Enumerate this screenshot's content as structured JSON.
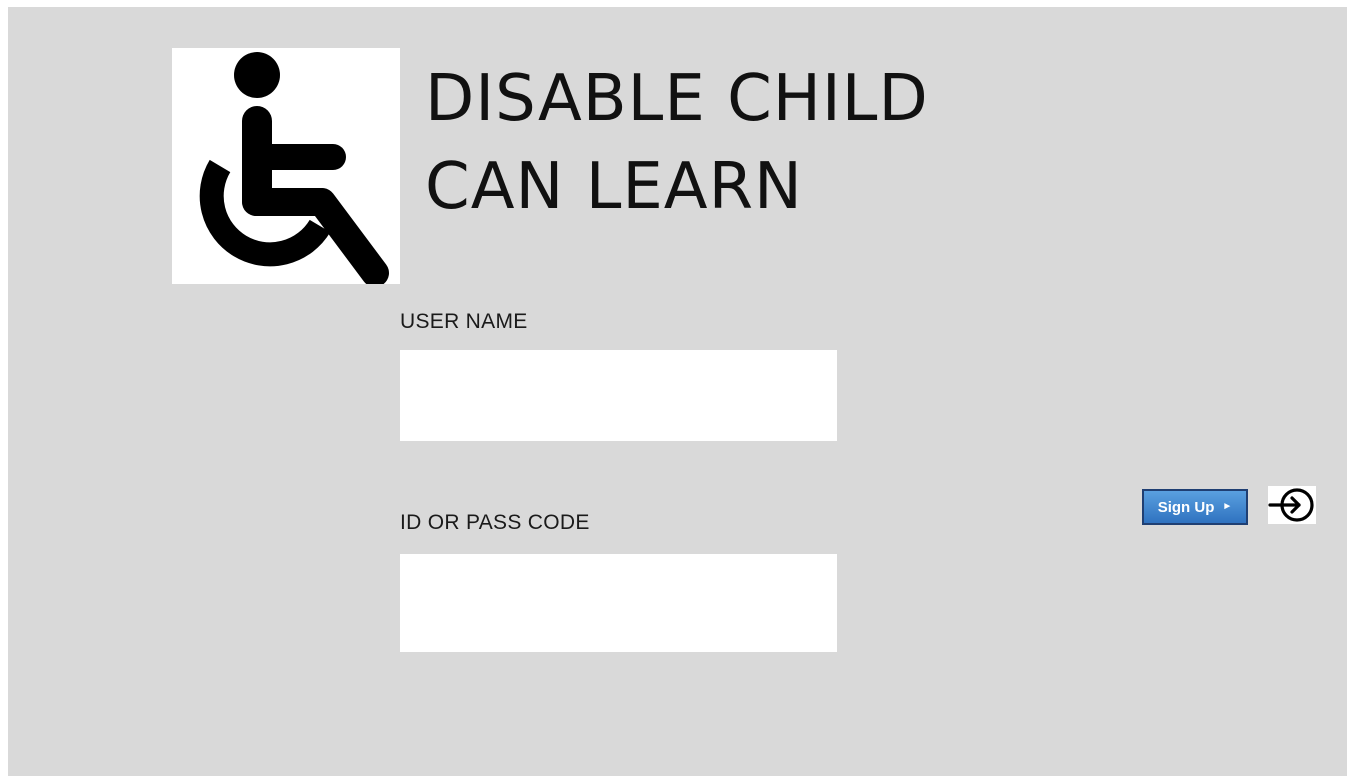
{
  "app": {
    "title_line1": "DISABLE CHILD",
    "title_line2": "CAN LEARN",
    "logo_icon": "wheelchair-accessibility-icon"
  },
  "form": {
    "username_label": "USER NAME",
    "username_value": "",
    "passcode_label": "ID OR PASS CODE",
    "passcode_value": ""
  },
  "actions": {
    "signup_label": "Sign Up",
    "signup_arrow": "►",
    "login_icon": "login-enter-icon"
  },
  "colors": {
    "background": "#d9d9d9",
    "signup_button": "#3a7dcb",
    "text": "#111111"
  }
}
